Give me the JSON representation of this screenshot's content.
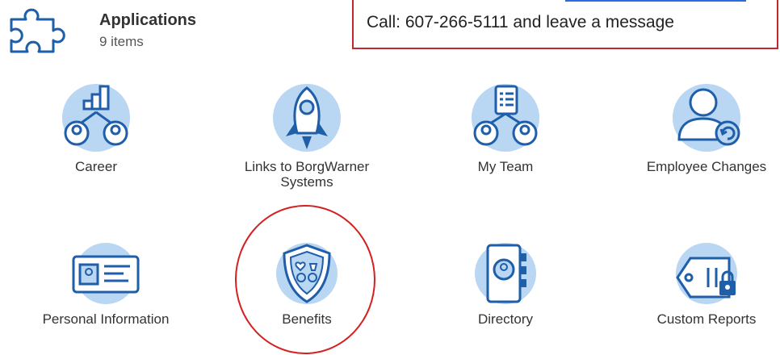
{
  "header": {
    "title": "Applications",
    "count": "9 items"
  },
  "callout": {
    "text": "Call: 607-266-5111 and leave a message",
    "border_color": "#c0282d"
  },
  "icon_fill": "#b9d6f2",
  "icon_stroke": "#1f5ea8",
  "apps": [
    {
      "label": "Career",
      "icon": "career-icon"
    },
    {
      "label": "Links to BorgWarner Systems",
      "icon": "rocket-icon"
    },
    {
      "label": "My Team",
      "icon": "team-icon"
    },
    {
      "label": "Employee Changes",
      "icon": "employee-changes-icon"
    },
    {
      "label": "Personal Information",
      "icon": "id-card-icon"
    },
    {
      "label": "Benefits",
      "icon": "benefits-shield-icon"
    },
    {
      "label": "Directory",
      "icon": "directory-book-icon"
    },
    {
      "label": "Custom Reports",
      "icon": "reports-tag-icon"
    }
  ]
}
